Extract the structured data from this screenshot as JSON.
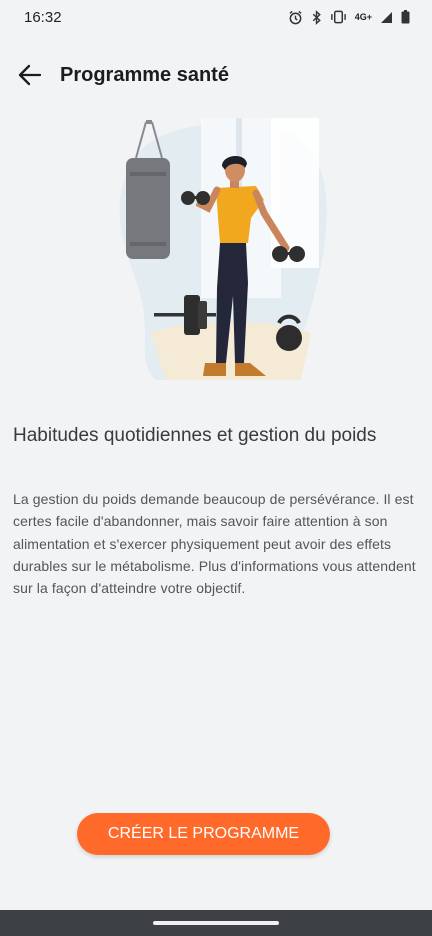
{
  "status_bar": {
    "time": "16:32",
    "network": "4G+",
    "icons": [
      "alarm-icon",
      "bluetooth-icon",
      "vibrate-icon",
      "signal-icon",
      "battery-icon"
    ]
  },
  "app_bar": {
    "back_icon": "arrow-left-icon",
    "title": "Programme santé"
  },
  "illustration": {
    "subject": "man-lifting-dumbbells-illustration"
  },
  "content": {
    "headline": "Habitudes quotidiennes et gestion du poids",
    "body": "La gestion du poids demande beaucoup de persévérance. Il est certes facile d'abandonner, mais savoir faire attention à son alimentation et s'exercer physiquement peut avoir des effets durables sur le métabolisme. Plus d'informations vous attendent sur la façon d'atteindre votre objectif."
  },
  "cta": {
    "label": "CRÉER LE PROGRAMME"
  },
  "colors": {
    "accent": "#ff6a2b",
    "background": "#f2f3f5",
    "nav_bar": "#3d4146"
  }
}
